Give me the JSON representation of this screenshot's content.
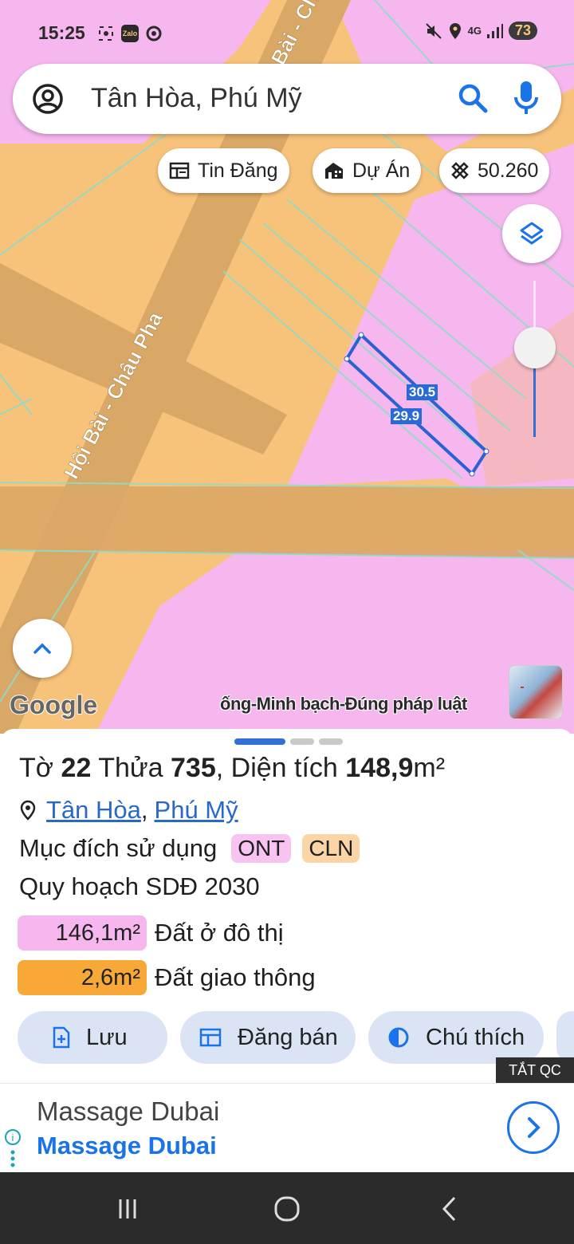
{
  "status_bar": {
    "time": "15:25",
    "left_icons": [
      "screenshot-icon",
      "zalo-icon",
      "chrome-icon"
    ],
    "zalo_label": "Zalo",
    "network": "4G",
    "battery": "73"
  },
  "search": {
    "value": "Tân Hòa, Phú Mỹ"
  },
  "chips": {
    "tin_dang": "Tin Đăng",
    "du_an": "Dự Án",
    "measure": "50.260"
  },
  "map": {
    "road_name": "Hội Bài - Châu Pha",
    "road_name_top": "Bài - Ch",
    "edge_label_1": "30.5",
    "edge_label_2": "29.9",
    "google": "Google",
    "ticker": "ống-Minh bạch-Đúng pháp luật",
    "colors": {
      "residential": "#f7c27a",
      "urban": "#f6b7ef",
      "road": "#d9a766",
      "lot_outline": "#2a62d4"
    }
  },
  "sheet": {
    "to_label": "Tờ",
    "to_value": "22",
    "thua_label": "Thửa",
    "thua_value": "735",
    "dien_tich_label": ", Diện tích",
    "dien_tich_value": "148,9",
    "dien_tich_unit": "m²",
    "location_a": "Tân Hòa",
    "location_sep": ",",
    "location_b": "Phú Mỹ",
    "purpose_label": "Mục đích sử dụng",
    "purpose_tags": [
      "ONT",
      "CLN"
    ],
    "plan_label": "Quy hoạch SDĐ 2030",
    "areas": [
      {
        "value": "146,1m²",
        "label": "Đất ở đô thị",
        "color": "#f6b7ef"
      },
      {
        "value": "2,6m²",
        "label": "Đất giao thông",
        "color": "#f7a837"
      }
    ],
    "actions": [
      "Lưu",
      "Đăng bán",
      "Chú thích"
    ]
  },
  "ad": {
    "close_label": "TẮT QC",
    "title": "Massage Dubai",
    "subtitle": "Massage Dubai"
  }
}
